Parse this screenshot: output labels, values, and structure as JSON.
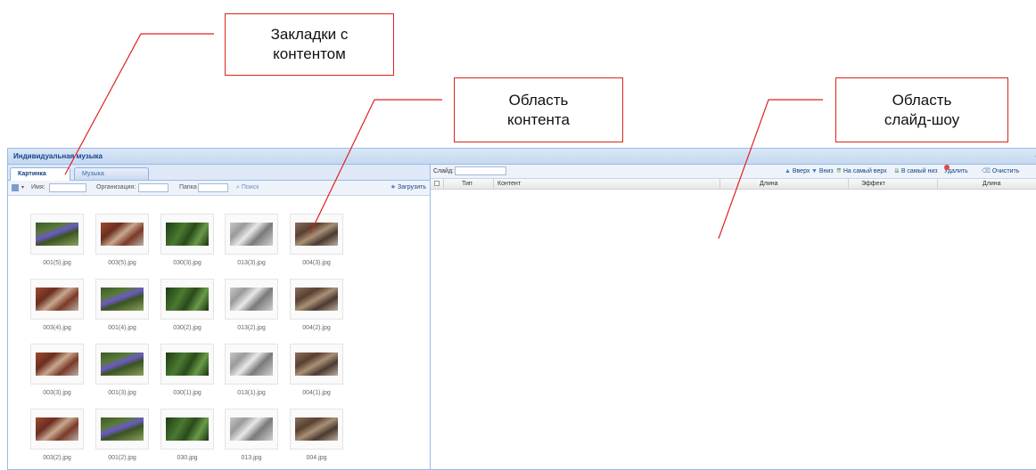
{
  "callouts": {
    "bookmarks": "Закладки с\nконтентом",
    "content": "Область\nконтента",
    "slideshow": "Область\nслайд-шоу"
  },
  "window": {
    "title": "Индивидуальная музыка",
    "close_glyph": "◦"
  },
  "tabs": [
    "Картинка",
    "Музыка"
  ],
  "left_toolbar": {
    "name_label": "Имя:",
    "org_label": "Организация:",
    "folder_label": "Папка",
    "search_label": "Поиск",
    "upload_label": "Загрузить"
  },
  "thumbnails": [
    {
      "caption": "001(5).jpg",
      "kind": "flowers"
    },
    {
      "caption": "003(5).jpg",
      "kind": "leaves"
    },
    {
      "caption": "030(3).jpg",
      "kind": "green"
    },
    {
      "caption": "013(3).jpg",
      "kind": "stone"
    },
    {
      "caption": "004(3).jpg",
      "kind": "brown"
    },
    {
      "caption": "003(4).jpg",
      "kind": "leaves"
    },
    {
      "caption": "001(4).jpg",
      "kind": "flowers"
    },
    {
      "caption": "030(2).jpg",
      "kind": "green"
    },
    {
      "caption": "013(2).jpg",
      "kind": "stone"
    },
    {
      "caption": "004(2).jpg",
      "kind": "brown"
    },
    {
      "caption": "003(3).jpg",
      "kind": "leaves"
    },
    {
      "caption": "001(3).jpg",
      "kind": "flowers"
    },
    {
      "caption": "030(1).jpg",
      "kind": "green"
    },
    {
      "caption": "013(1).jpg",
      "kind": "stone"
    },
    {
      "caption": "004(1).jpg",
      "kind": "brown"
    },
    {
      "caption": "003(2).jpg",
      "kind": "leaves"
    },
    {
      "caption": "001(2).jpg",
      "kind": "flowers"
    },
    {
      "caption": "030.jpg",
      "kind": "green"
    },
    {
      "caption": "013.jpg",
      "kind": "stone"
    },
    {
      "caption": "004.jpg",
      "kind": "brown"
    }
  ],
  "right_toolbar": {
    "slide_label": "Слайд:",
    "up": "Вверх",
    "down": "Вниз",
    "to_top": "На самый верх",
    "to_bottom": "В самый низ",
    "delete": "Удалить",
    "clear": "Очистить"
  },
  "grid_columns": [
    "Тип",
    "Контент",
    "Длина",
    "Эффект",
    "Длина"
  ],
  "colors": {
    "callout_border": "#d9251c",
    "pointer_line": "#e02020",
    "panel_border": "#99bbe8",
    "title_text": "#15428b"
  }
}
